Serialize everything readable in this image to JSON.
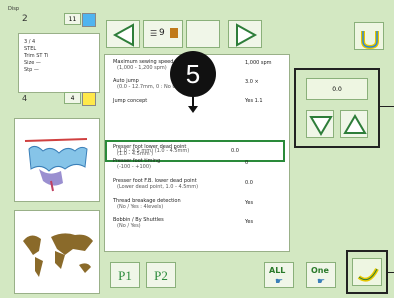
{
  "top_left": {
    "header_text": "Disp",
    "num_left": "2",
    "num_right": "11",
    "info_lines": [
      "3 / 4",
      "STEL",
      "Trim  ST  Ti",
      "Size  —",
      "Stp  —"
    ],
    "counter": "4",
    "counter_right": "4"
  },
  "nav": {
    "page_indicator": "9"
  },
  "callout": {
    "number": "5"
  },
  "list": {
    "rows": [
      {
        "label": "Maximum sewing speed",
        "sub": "(1,000 - 1,200 spm)",
        "value": "1,000 spm"
      },
      {
        "label": "Auto jump",
        "sub": "(0.0 - 12.7mm, 0 : No use)",
        "value": "3.0 ×"
      },
      {
        "label": "Jump concept",
        "sub": "",
        "value": "Yes  1.1"
      },
      {
        "label": "Presser foot lower dead point",
        "sub": "(1.0 - 4.5mm )",
        "value": "0.0"
      },
      {
        "label": "",
        "sub": "(1.0 - 4.5 mm)   (1.0 - 4.5mm)",
        "value": ""
      },
      {
        "label": "Presser foot timing",
        "sub": "(-100 - +100)",
        "value": "0"
      },
      {
        "label": "Presser foot F.B. lower dead point",
        "sub": "(Lower dead point, 1.0 - 4.5mm)",
        "value": "0.0"
      },
      {
        "label": "Thread breakage detection",
        "sub": "(No / Yes : 4levels)",
        "value": "Yes"
      },
      {
        "label": "Bobbin / By Shuttles",
        "sub": "(No / Yes)",
        "value": "Yes"
      }
    ]
  },
  "adjust": {
    "value": "0.0"
  },
  "tabs": {
    "p1": "P1",
    "p2": "P2"
  },
  "bottom_buttons": {
    "all": "ALL",
    "one": "One"
  },
  "colors": {
    "bg": "#d3e8c2",
    "highlight": "#2a8a3a",
    "yellow": "#ffe84a",
    "accent_blue": "#2a9be0"
  }
}
